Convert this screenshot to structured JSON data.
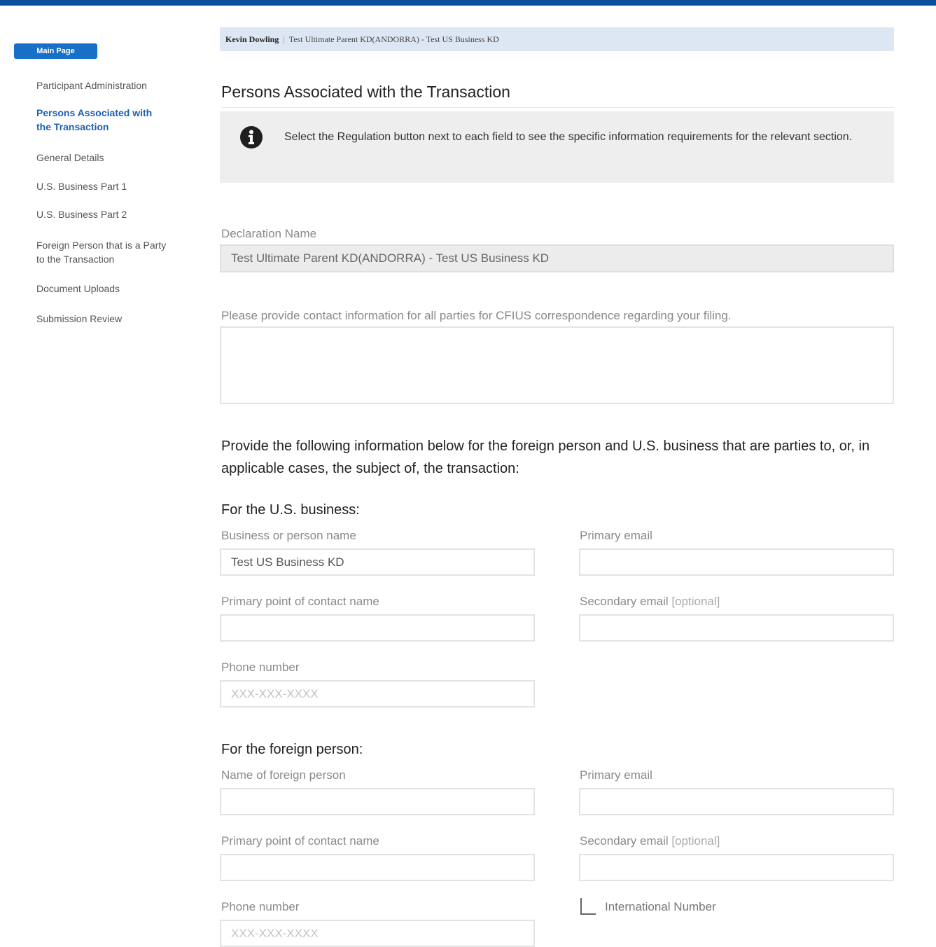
{
  "sidebar": {
    "main_page": "Main Page",
    "items": [
      {
        "label": "Participant Administration"
      },
      {
        "label": "Persons Associated with the Transaction"
      },
      {
        "label": "General Details"
      },
      {
        "label": "U.S. Business Part 1"
      },
      {
        "label": "U.S. Business Part 2"
      },
      {
        "label": "Foreign Person that is a Party to the Transaction"
      },
      {
        "label": "Document Uploads"
      },
      {
        "label": "Submission Review"
      }
    ]
  },
  "breadcrumb": {
    "user": "Kevin Dowling",
    "separator": "|",
    "filing": "Test Ultimate Parent KD(ANDORRA) - Test US Business KD"
  },
  "page": {
    "title": "Persons Associated with the Transaction",
    "info": "Select the Regulation button next to each field to see the specific information requirements for the relevant section.",
    "info_icon": "info-circle-icon"
  },
  "declaration": {
    "label": "Declaration Name",
    "value": "Test Ultimate Parent KD(ANDORRA) - Test US Business KD"
  },
  "contact": {
    "label": "Please provide contact information for all parties for CFIUS correspondence regarding your filing.",
    "value": ""
  },
  "lead_text": "Provide the following information below for the foreign person and U.S. business that are parties to, or, in applicable cases, the subject of, the transaction:",
  "us_business": {
    "heading": "For the U.S. business:",
    "name_label": "Business or person name",
    "name_value": "Test US Business KD",
    "primary_email_label": "Primary email",
    "poc_label": "Primary point of contact name",
    "secondary_email_label": "Secondary email",
    "optional_tag": "[optional]",
    "phone_label": "Phone number",
    "phone_placeholder": "XXX-XXX-XXXX"
  },
  "foreign_person": {
    "heading": "For the foreign person:",
    "name_label": "Name of foreign person",
    "primary_email_label": "Primary email",
    "poc_label": "Primary point of contact name",
    "secondary_email_label": "Secondary email",
    "optional_tag": "[optional]",
    "phone_label": "Phone number",
    "phone_placeholder": "XXX-XXX-XXXX",
    "intl_label": "International Number",
    "intl_checked": false
  }
}
